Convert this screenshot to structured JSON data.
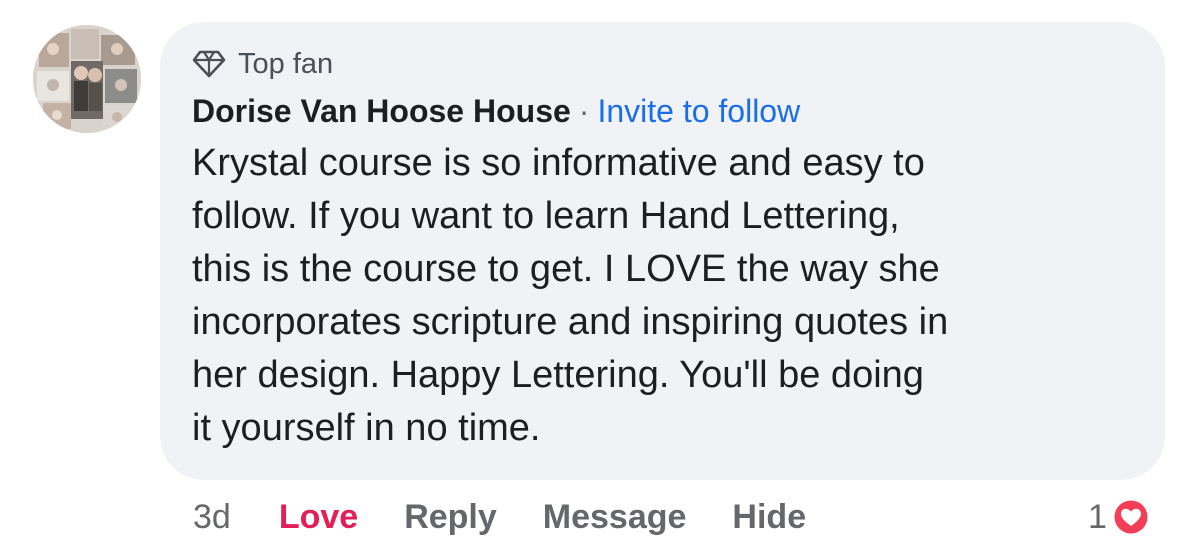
{
  "comment": {
    "badge": "Top fan",
    "author": "Dorise Van Hoose House",
    "separator": "·",
    "invite_link": "Invite to follow",
    "text": "Krystal course is so informative and easy to\nfollow.  If you want to learn Hand Lettering,\nthis is the course to get. I LOVE the way she\nincorporates scripture and inspiring quotes in\nher design.  Happy Lettering.  You'll be doing\nit yourself in no time."
  },
  "actions": {
    "time": "3d",
    "love": "Love",
    "reply": "Reply",
    "message": "Message",
    "hide": "Hide"
  },
  "reactions": {
    "count": "1",
    "icon": "heart-icon"
  },
  "colors": {
    "bubble": "#f0f2f5",
    "link": "#1a6ee8",
    "love": "#e41e56",
    "muted": "#65676b",
    "text": "#1c1e21"
  }
}
